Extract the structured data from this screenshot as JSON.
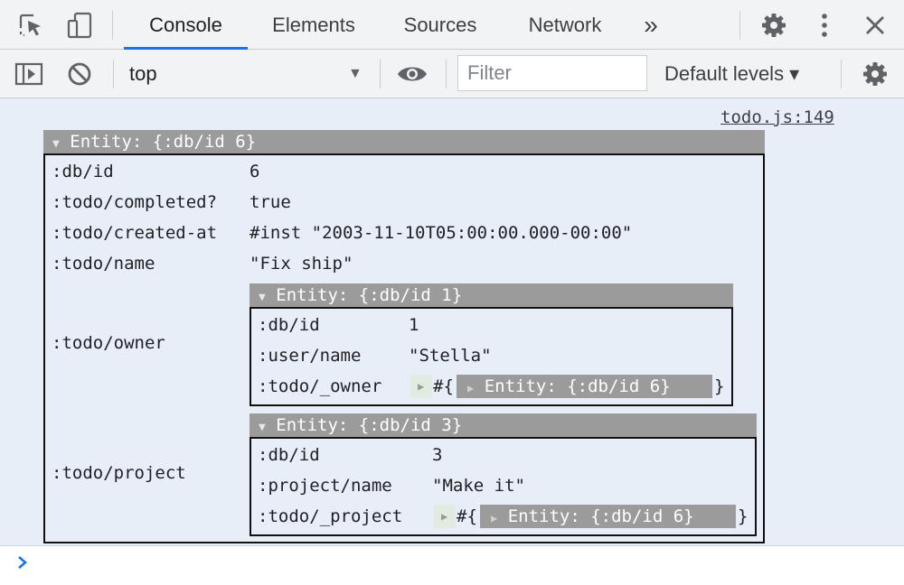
{
  "tabs": [
    {
      "label": "Console",
      "active": true
    },
    {
      "label": "Elements",
      "active": false
    },
    {
      "label": "Sources",
      "active": false
    },
    {
      "label": "Network",
      "active": false
    }
  ],
  "tab_overflow": "»",
  "toolbar": {
    "context": "top",
    "filter_placeholder": "Filter",
    "levels": "Default levels ▾"
  },
  "source_link": "todo.js:149",
  "entity": {
    "header": "Entity: {:db/id 6}",
    "rows": [
      {
        "key": ":db/id",
        "value": "6"
      },
      {
        "key": ":todo/completed?",
        "value": "true"
      },
      {
        "key": ":todo/created-at",
        "value": "#inst \"2003-11-10T05:00:00.000-00:00\""
      },
      {
        "key": ":todo/name",
        "value": "\"Fix ship\""
      },
      {
        "key": ":todo/owner",
        "nested": {
          "header": "Entity: {:db/id 1}",
          "rows": [
            {
              "key": ":db/id",
              "value": "1"
            },
            {
              "key": ":user/name",
              "value": "\"Stella\""
            },
            {
              "key": ":todo/_owner",
              "set_open": "#{",
              "ref": "Entity: {:db/id 6}",
              "set_close": "}"
            }
          ]
        }
      },
      {
        "key": ":todo/project",
        "nested": {
          "header": "Entity: {:db/id 3}",
          "rows": [
            {
              "key": ":db/id",
              "value": "3"
            },
            {
              "key": ":project/name",
              "value": "\"Make it\""
            },
            {
              "key": ":todo/_project",
              "set_open": "#{",
              "ref": "Entity: {:db/id 6}",
              "set_close": "}"
            }
          ]
        }
      }
    ]
  },
  "accent_color": "#1a73e8"
}
